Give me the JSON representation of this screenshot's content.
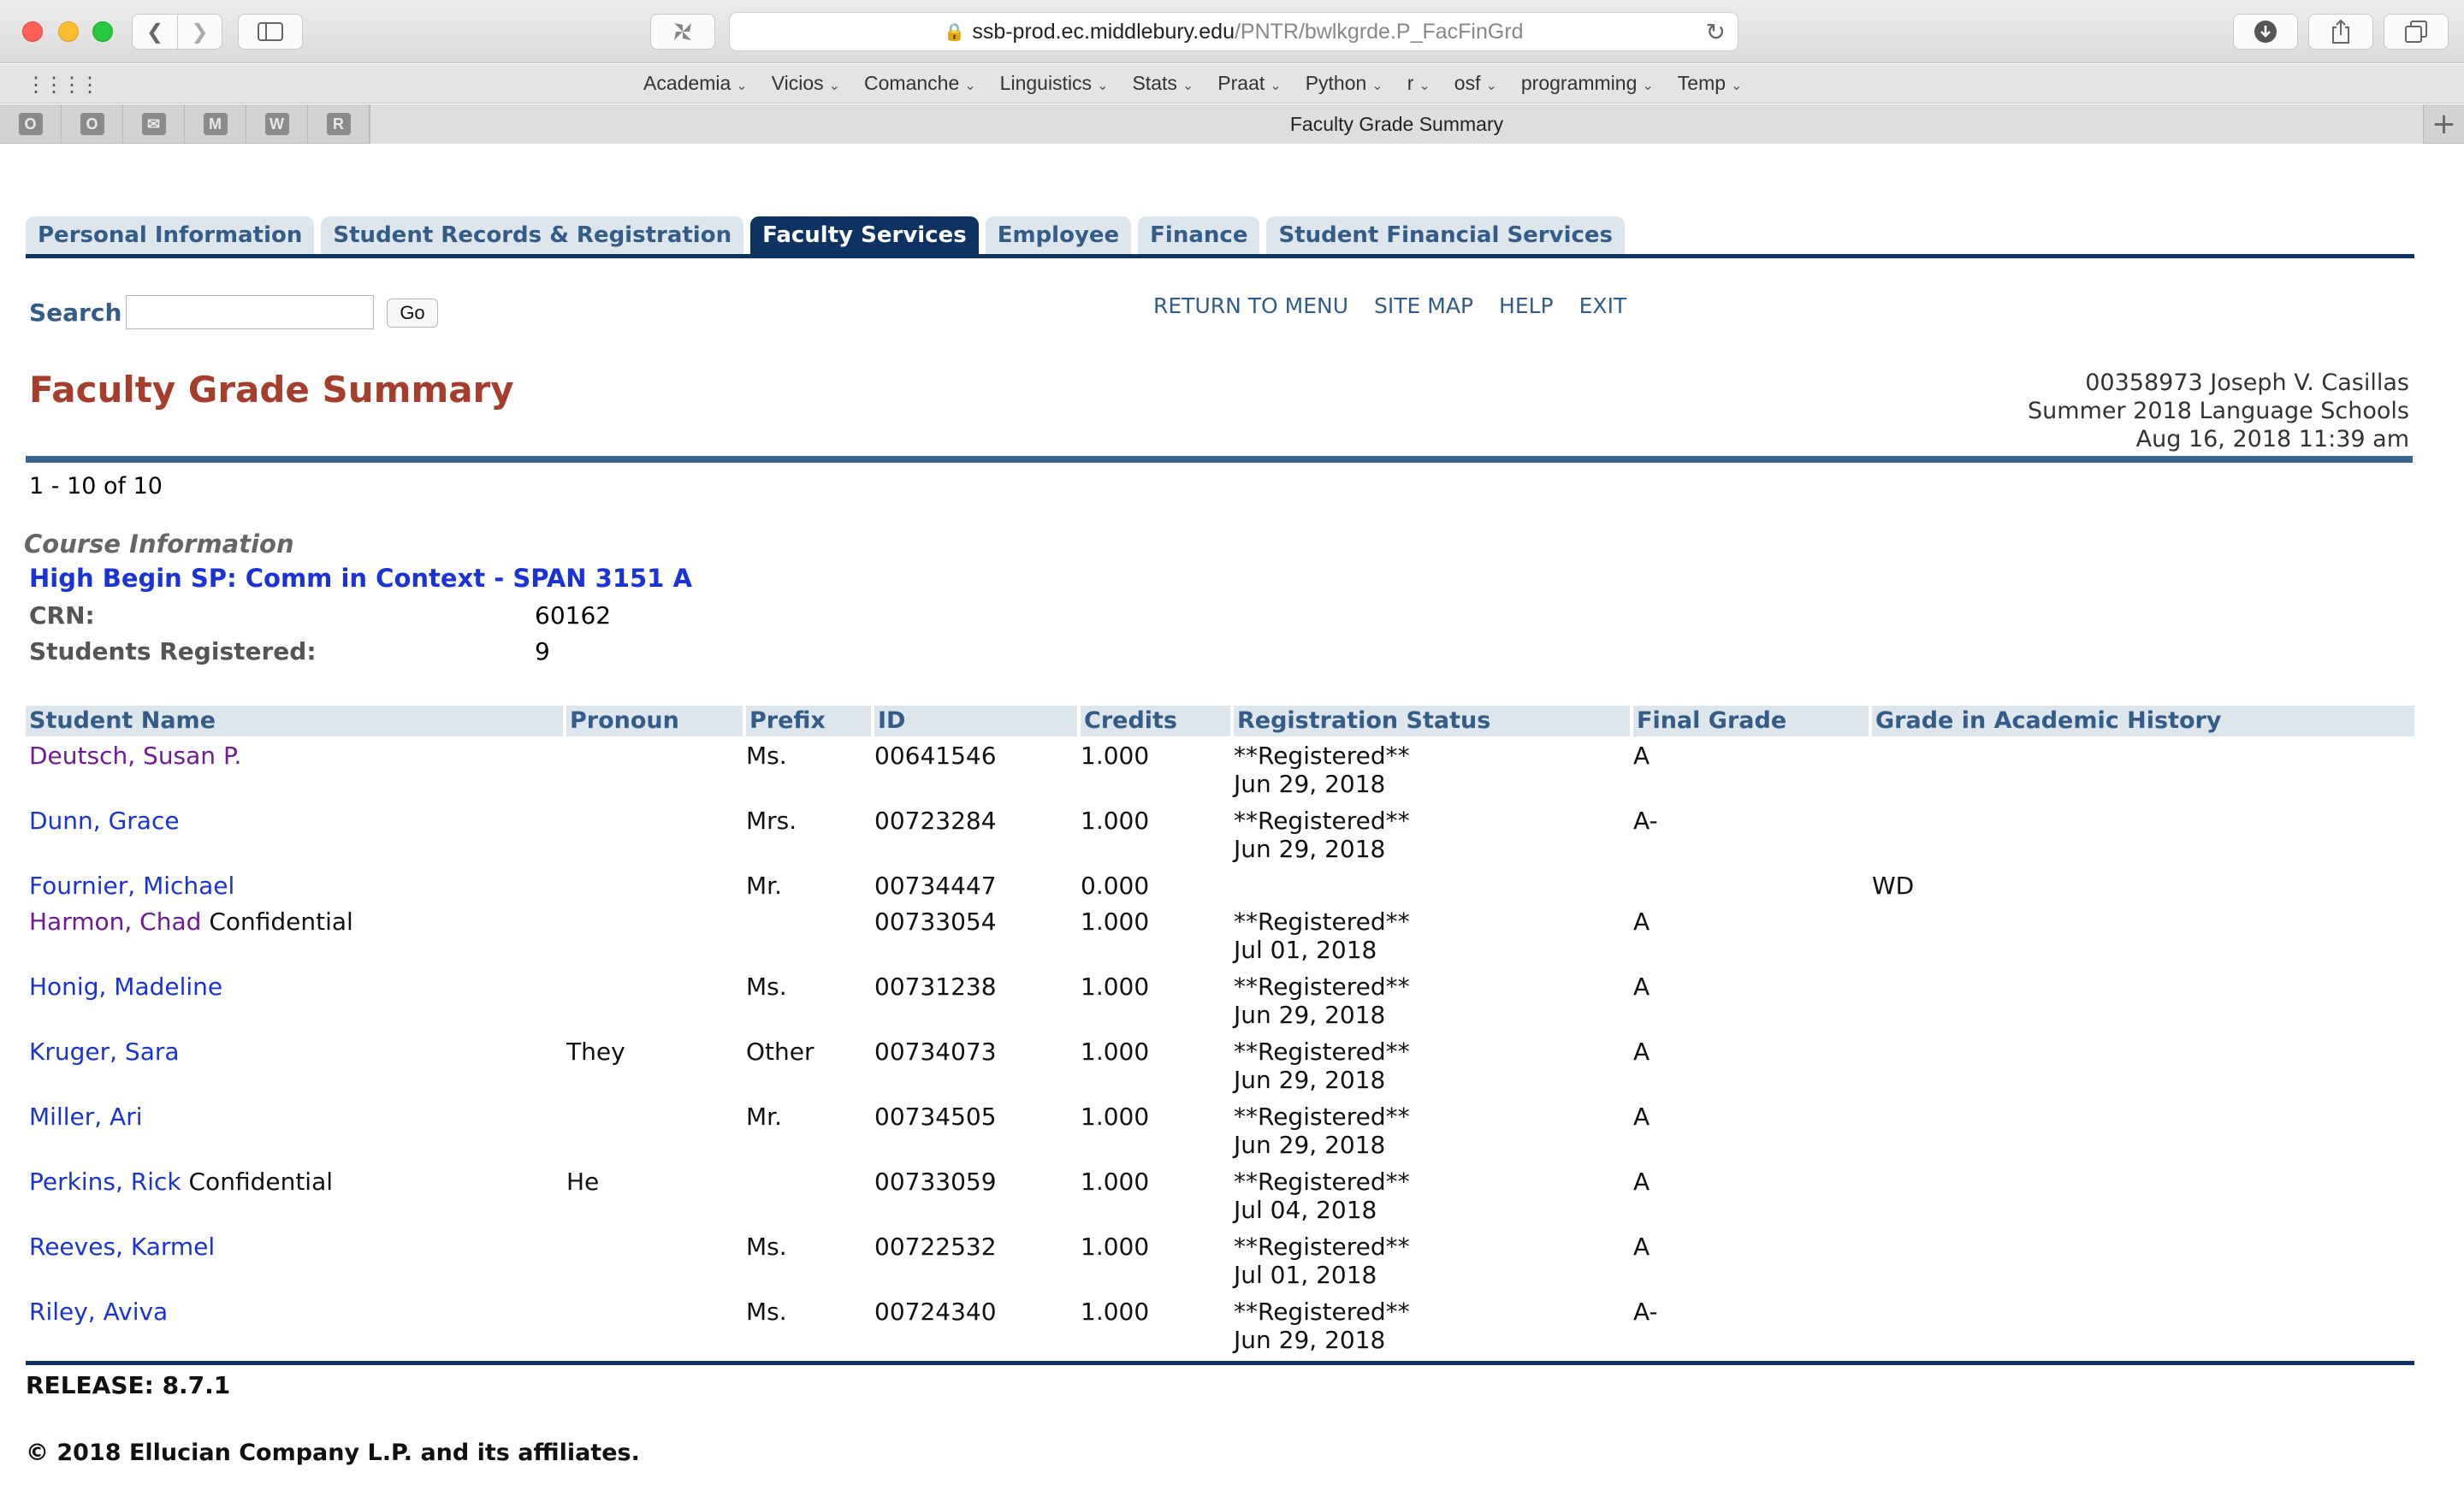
{
  "browser": {
    "url_host": "ssb-prod.ec.middlebury.edu",
    "url_path": "/PNTR/bwlkgrde.P_FacFinGrd",
    "tab_title": "Faculty Grade Summary",
    "pinned_tabs": [
      "O",
      "O",
      "✉",
      "M",
      "W",
      "R"
    ],
    "bookmarks": [
      "Academia",
      "Vicios",
      "Comanche",
      "Linguistics",
      "Stats",
      "Praat",
      "Python",
      "r",
      "osf",
      "programming",
      "Temp"
    ]
  },
  "nav": {
    "tabs": [
      "Personal Information",
      "Student Records & Registration",
      "Faculty Services",
      "Employee",
      "Finance",
      "Student Financial Services"
    ],
    "active_tab": "Faculty Services"
  },
  "search": {
    "label": "Search",
    "value": "",
    "go_label": "Go"
  },
  "top_links": [
    "RETURN TO MENU",
    "SITE MAP",
    "HELP",
    "EXIT"
  ],
  "page": {
    "title": "Faculty Grade Summary",
    "user_line": "00358973 Joseph V. Casillas",
    "term_line": "Summer 2018 Language Schools",
    "timestamp": "Aug 16, 2018 11:39 am",
    "record_count": "1 - 10 of 10"
  },
  "course": {
    "section_heading": "Course Information",
    "name": "High Begin SP: Comm in Context - SPAN 3151 A",
    "crn_label": "CRN:",
    "crn_value": "60162",
    "registered_label": "Students Registered:",
    "registered_value": "9"
  },
  "table": {
    "headers": [
      "Student Name",
      "Pronoun",
      "Prefix",
      "ID",
      "Credits",
      "Registration Status",
      "Final Grade",
      "Grade in Academic History"
    ],
    "rows": [
      {
        "name": "Deutsch, Susan P.",
        "visited": true,
        "confidential": "",
        "pronoun": "",
        "prefix": "Ms.",
        "id": "00641546",
        "credits": "1.000",
        "status": "**Registered**",
        "status_date": "Jun 29, 2018",
        "final": "A",
        "history": ""
      },
      {
        "name": "Dunn, Grace",
        "visited": false,
        "confidential": "",
        "pronoun": "",
        "prefix": "Mrs.",
        "id": "00723284",
        "credits": "1.000",
        "status": "**Registered**",
        "status_date": "Jun 29, 2018",
        "final": "A-",
        "history": ""
      },
      {
        "name": "Fournier, Michael",
        "visited": false,
        "confidential": "",
        "pronoun": "",
        "prefix": "Mr.",
        "id": "00734447",
        "credits": "0.000",
        "status": "",
        "status_date": "",
        "final": "",
        "history": "WD"
      },
      {
        "name": "Harmon, Chad",
        "visited": true,
        "confidential": "Confidential",
        "pronoun": "",
        "prefix": "",
        "id": "00733054",
        "credits": "1.000",
        "status": "**Registered**",
        "status_date": "Jul 01, 2018",
        "final": "A",
        "history": ""
      },
      {
        "name": "Honig, Madeline",
        "visited": false,
        "confidential": "",
        "pronoun": "",
        "prefix": "Ms.",
        "id": "00731238",
        "credits": "1.000",
        "status": "**Registered**",
        "status_date": "Jun 29, 2018",
        "final": "A",
        "history": ""
      },
      {
        "name": "Kruger, Sara",
        "visited": false,
        "confidential": "",
        "pronoun": "They",
        "prefix": "Other",
        "id": "00734073",
        "credits": "1.000",
        "status": "**Registered**",
        "status_date": "Jun 29, 2018",
        "final": "A",
        "history": ""
      },
      {
        "name": "Miller, Ari",
        "visited": false,
        "confidential": "",
        "pronoun": "",
        "prefix": "Mr.",
        "id": "00734505",
        "credits": "1.000",
        "status": "**Registered**",
        "status_date": "Jun 29, 2018",
        "final": "A",
        "history": ""
      },
      {
        "name": "Perkins, Rick",
        "visited": false,
        "confidential": "Confidential",
        "pronoun": "He",
        "prefix": "",
        "id": "00733059",
        "credits": "1.000",
        "status": "**Registered**",
        "status_date": "Jul 04, 2018",
        "final": "A",
        "history": ""
      },
      {
        "name": "Reeves, Karmel",
        "visited": false,
        "confidential": "",
        "pronoun": "",
        "prefix": "Ms.",
        "id": "00722532",
        "credits": "1.000",
        "status": "**Registered**",
        "status_date": "Jul 01, 2018",
        "final": "A",
        "history": ""
      },
      {
        "name": "Riley, Aviva",
        "visited": false,
        "confidential": "",
        "pronoun": "",
        "prefix": "Ms.",
        "id": "00724340",
        "credits": "1.000",
        "status": "**Registered**",
        "status_date": "Jun 29, 2018",
        "final": "A-",
        "history": ""
      }
    ]
  },
  "footer": {
    "release": "RELEASE: 8.7.1",
    "copyright": "© 2018 Ellucian Company L.P. and its affiliates."
  },
  "colors": {
    "nav_dark": "#0d3363",
    "nav_light": "#dde5ed",
    "title_red": "#a63e2e",
    "link_blue": "#1a33d6",
    "visited_purple": "#6f1a98"
  }
}
